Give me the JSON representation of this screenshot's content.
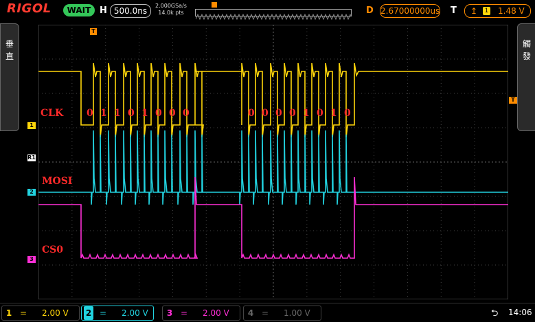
{
  "topbar": {
    "logo": "RIGOL",
    "run_status": "WAIT",
    "h_label": "H",
    "timebase": "500.0ns",
    "sample_rate": "2.000GSa/s",
    "memory_depth": "14.0k pts",
    "d_label": "D",
    "delay": "2.67000000us",
    "t_label": "T",
    "trigger_edge_icon": "rising-edge-icon",
    "trigger_source": "1",
    "trigger_level": "1.48 V"
  },
  "side_tabs": {
    "left": "垂\n直",
    "right": "觸\n發"
  },
  "markers": {
    "ch1": "1",
    "ref": "R1",
    "ch2": "2",
    "ch3": "3",
    "trigger_level": "T",
    "trigger_time": "T"
  },
  "annotations": {
    "clk": "CLK",
    "mosi": "MOSI",
    "cs0": "CS0",
    "bits_group1": [
      "0",
      "1",
      "1",
      "0",
      "1",
      "0",
      "0",
      "0"
    ],
    "bits_group2": [
      "0",
      "0",
      "0",
      "0",
      "1",
      "0",
      "1",
      "0"
    ]
  },
  "channels": [
    {
      "num": "1",
      "coupling": "=",
      "scale": "2.00 V",
      "color": "#ffd60a"
    },
    {
      "num": "2",
      "coupling": "=",
      "scale": "2.00 V",
      "color": "#22d3e0"
    },
    {
      "num": "3",
      "coupling": "=",
      "scale": "2.00 V",
      "color": "#ff2fd6"
    },
    {
      "num": "4",
      "coupling": "=",
      "scale": "1.00 V",
      "color": "#666666"
    }
  ],
  "statusbar": {
    "usb_icon": "usb-icon",
    "time": "14:06"
  },
  "colors": {
    "ch1": "#ffd60a",
    "ch2": "#22d3e0",
    "ch3": "#ff2fd6",
    "trigger": "#ff8c00",
    "annotation": "#ff2a2a"
  }
}
